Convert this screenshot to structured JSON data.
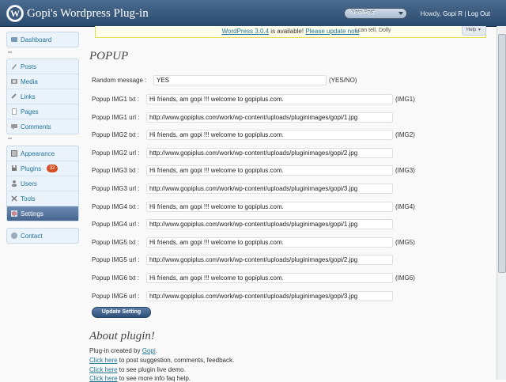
{
  "header": {
    "site_title": "Gopi's Wordpress Plug-in",
    "new_post": "New Post",
    "howdy": "Howdy,",
    "user": "Gopi R",
    "separator": "|",
    "logout": "Log Out"
  },
  "sidebar": {
    "groups": [
      [
        {
          "label": "Dashboard",
          "icon": "dashboard-icon"
        }
      ],
      [
        {
          "label": "Posts",
          "icon": "posts-icon"
        },
        {
          "label": "Media",
          "icon": "media-icon"
        },
        {
          "label": "Links",
          "icon": "links-icon"
        },
        {
          "label": "Pages",
          "icon": "pages-icon"
        },
        {
          "label": "Comments",
          "icon": "comments-icon"
        }
      ],
      [
        {
          "label": "Appearance",
          "icon": "appearance-icon"
        },
        {
          "label": "Plugins",
          "icon": "plugins-icon",
          "badge": "32"
        },
        {
          "label": "Users",
          "icon": "users-icon"
        },
        {
          "label": "Tools",
          "icon": "tools-icon"
        },
        {
          "label": "Settings",
          "icon": "settings-icon",
          "current": true
        }
      ],
      [
        {
          "label": "Contact",
          "icon": "contact-icon"
        }
      ]
    ]
  },
  "notice": {
    "version_link": "WordPress 3.0.4",
    "text": " is available! ",
    "update_link": "Please update now",
    "dolly": "I can tell, Dolly",
    "help": "Help"
  },
  "page": {
    "title": "POPUP",
    "random_label": "Random message :",
    "random_value": "YES",
    "random_suffix": "(YES/NO)",
    "rows": [
      {
        "label": "Popup IMG1 txt :",
        "value": "Hi friends, am gopi !!! welcome to gopiplus.com.",
        "suffix": "(IMG1)"
      },
      {
        "label": "Popup IMG1 url :",
        "value": "http://www.gopiplus.com/work/wp-content/uploads/pluginimages/gopi/1.jpg",
        "suffix": ""
      },
      {
        "label": "Popup IMG2 txt :",
        "value": "Hi friends, am gopi !!! welcome to gopiplus.com.",
        "suffix": "(IMG2)"
      },
      {
        "label": "Popup IMG2 url :",
        "value": "http://www.gopiplus.com/work/wp-content/uploads/pluginimages/gopi/2.jpg",
        "suffix": ""
      },
      {
        "label": "Popup IMG3 txt :",
        "value": "Hi friends, am gopi !!! welcome to gopiplus.com.",
        "suffix": "(IMG3)"
      },
      {
        "label": "Popup IMG3 url :",
        "value": "http://www.gopiplus.com/work/wp-content/uploads/pluginimages/gopi/3.jpg",
        "suffix": ""
      },
      {
        "label": "Popup IMG4 txt :",
        "value": "Hi friends, am gopi !!! welcome to gopiplus.com.",
        "suffix": "(IMG4)"
      },
      {
        "label": "Popup IMG4 url :",
        "value": "http://www.gopiplus.com/work/wp-content/uploads/pluginimages/gopi/1.jpg",
        "suffix": ""
      },
      {
        "label": "Popup IMG5 txt :",
        "value": "Hi friends, am gopi !!! welcome to gopiplus.com.",
        "suffix": "(IMG5)"
      },
      {
        "label": "Popup IMG5 url :",
        "value": "http://www.gopiplus.com/work/wp-content/uploads/pluginimages/gopi/2.jpg",
        "suffix": ""
      },
      {
        "label": "Popup IMG6 txt :",
        "value": "Hi friends, am gopi !!! welcome to gopiplus.com.",
        "suffix": "(IMG6)"
      },
      {
        "label": "Popup IMG6 url :",
        "value": "http://www.gopiplus.com/work/wp-content/uploads/pluginimages/gopi/3.jpg",
        "suffix": ""
      }
    ],
    "update_button": "Update Setting"
  },
  "about": {
    "title": "About plugin!",
    "created_text": "Plug-in created by ",
    "created_link": "Gopi",
    "created_end": ".",
    "lines": [
      {
        "link": "Click here",
        "text": " to post suggestion, comments, feedback."
      },
      {
        "link": "Click here",
        "text": " to see plugin live demo."
      },
      {
        "link": "Click here",
        "text": " to see more info faq help."
      }
    ]
  }
}
